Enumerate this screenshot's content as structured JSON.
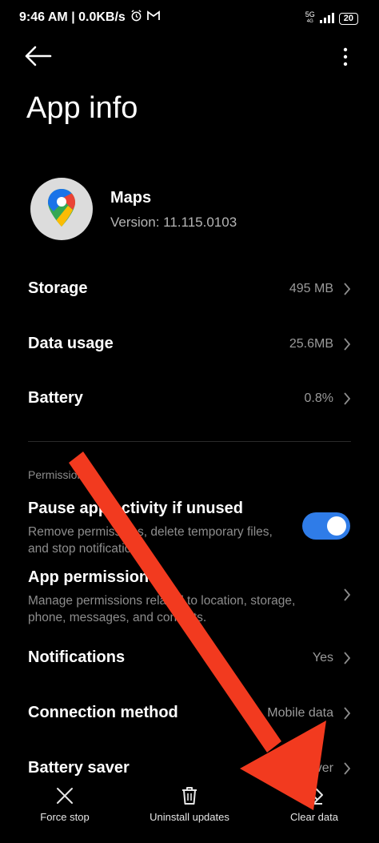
{
  "status_bar": {
    "time_net": "9:46 AM | 0.0KB/s",
    "network": "5G",
    "network_sub": "4G",
    "battery": "20"
  },
  "page": {
    "title": "App info"
  },
  "app": {
    "name": "Maps",
    "version": "Version: 11.115.0103",
    "icon": "google-maps-pin"
  },
  "rows": {
    "storage": {
      "title": "Storage",
      "value": "495 MB"
    },
    "data_usage": {
      "title": "Data usage",
      "value": "25.6MB"
    },
    "battery": {
      "title": "Battery",
      "value": "0.8%"
    }
  },
  "permissions": {
    "section_label": "Permissions",
    "pause": {
      "title": "Pause app activity if unused",
      "sub": "Remove permissions, delete temporary files, and stop notifications",
      "enabled": true
    },
    "app_permissions": {
      "title": "App permissions",
      "sub": "Manage permissions related to location, storage, phone, messages, and contacts."
    },
    "notifications": {
      "title": "Notifications",
      "value": "Yes"
    },
    "connection": {
      "title": "Connection method",
      "value": "Mobile data"
    },
    "battery_saver": {
      "title": "Battery saver",
      "value": "Battery saver"
    }
  },
  "bottom": {
    "force_stop": "Force stop",
    "uninstall_updates": "Uninstall updates",
    "clear_data": "Clear data"
  },
  "colors": {
    "toggle": "#2f7ce8",
    "arrow": "#f23a1f",
    "background": "#000000"
  }
}
